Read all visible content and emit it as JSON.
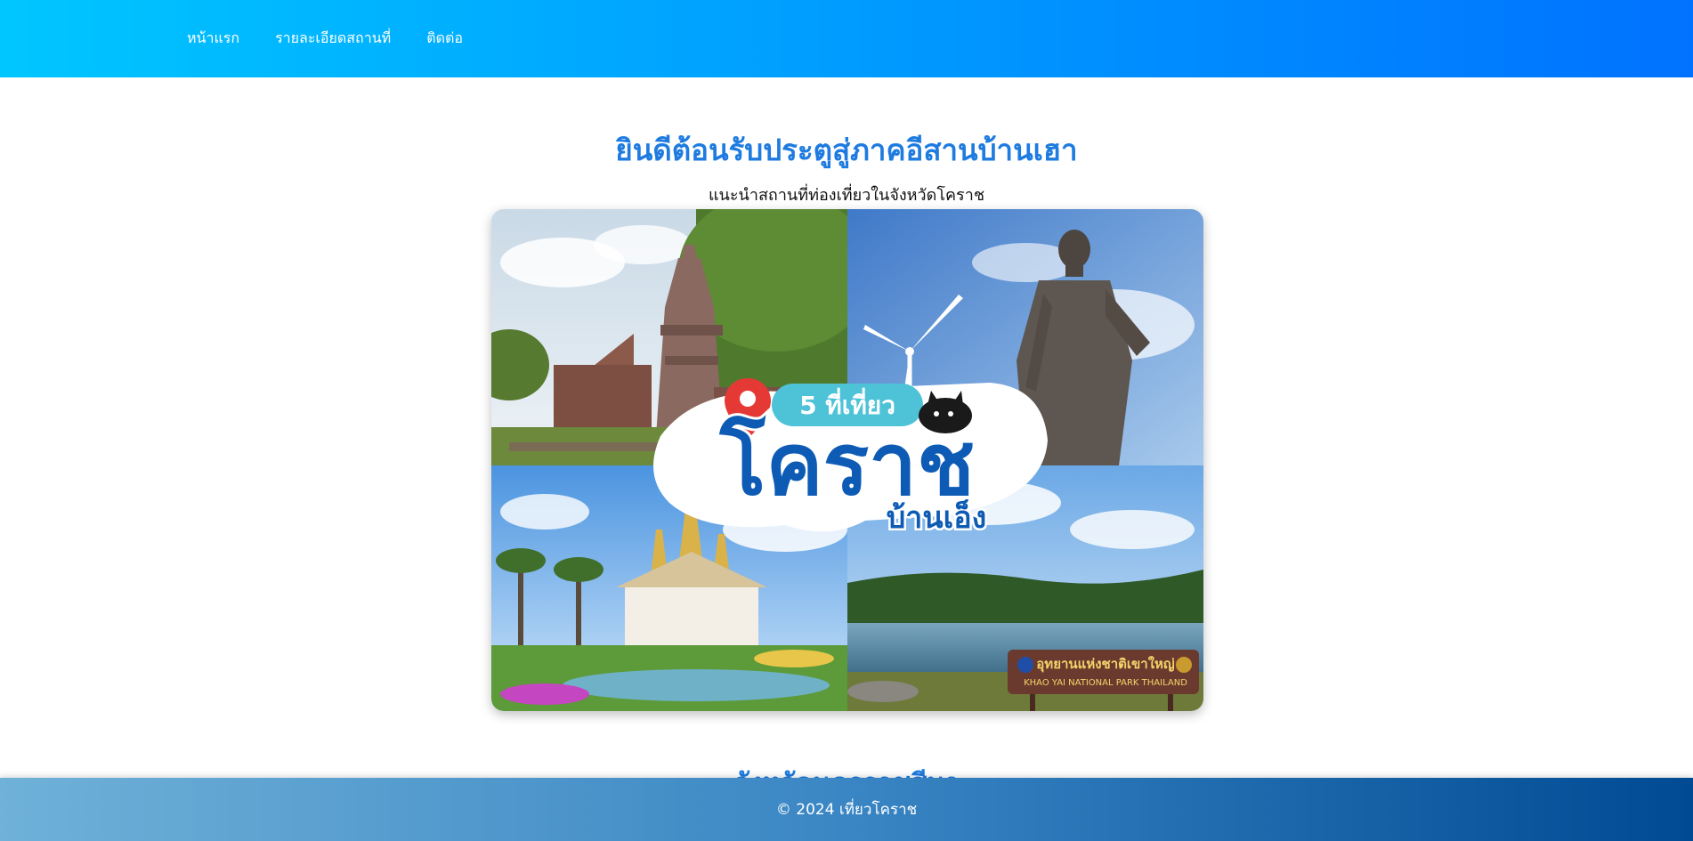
{
  "nav": {
    "links": [
      "หน้าแรก",
      "รายละเอียดสถานที่",
      "ติดต่อ"
    ]
  },
  "hero": {
    "title": "ยินดีต้อนรับประตูสู่ภาคอีสานบ้านเฮา",
    "subtitle": "แนะนำสถานที่ท่องเที่ยวในจังหวัดโคราช"
  },
  "collage": {
    "badge_text": "5 ที่เที่ยว",
    "big_text": "โคราช",
    "small_text": "บ้านเอ็ง",
    "sign_text_th": "อุทยานแห่งชาติเขาใหญ่",
    "sign_text_en": "KHAO YAI NATIONAL PARK THAILAND",
    "colors": {
      "sky": "#8ec5ee",
      "forest": "#3c6e2c",
      "lake": "#5a8fb0",
      "brand_blue": "#0d5bb5",
      "badge": "#4ec3d8",
      "pin": "#e53935"
    }
  },
  "section": {
    "title": "จังหวัดนครราชสีมา"
  },
  "footer": {
    "text": "© 2024 เที่ยวโคราช"
  }
}
